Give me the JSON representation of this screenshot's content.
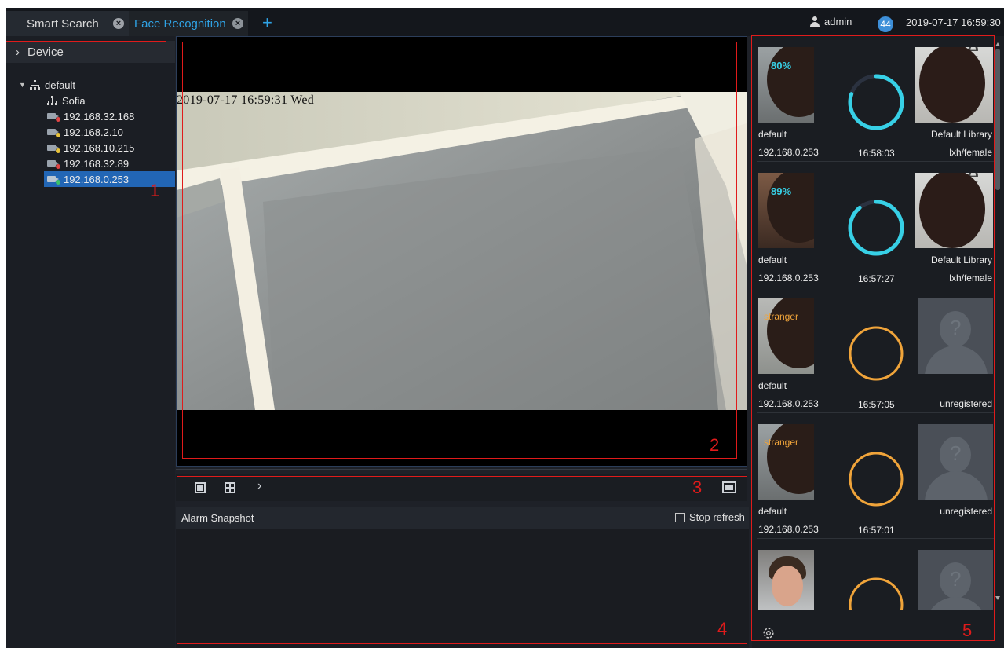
{
  "tabs": [
    {
      "label": "Smart Search",
      "active": false
    },
    {
      "label": "Face Recognition",
      "active": true
    }
  ],
  "header": {
    "user": "admin",
    "notifications": "44",
    "datetime": "2019-07-17 16:59:30"
  },
  "device_panel": {
    "title": "Device",
    "root": "default",
    "group": "Sofia",
    "devices": [
      {
        "ip": "192.168.32.168",
        "status": "offline"
      },
      {
        "ip": "192.168.2.10",
        "status": "warning"
      },
      {
        "ip": "192.168.10.215",
        "status": "warning"
      },
      {
        "ip": "192.168.32.89",
        "status": "offline"
      },
      {
        "ip": "192.168.0.253",
        "status": "online",
        "selected": true
      }
    ]
  },
  "video": {
    "osd": "2019-07-17 16:59:31 Wed"
  },
  "alarm": {
    "title": "Alarm Snapshot",
    "stop_refresh": "Stop refresh"
  },
  "feed": [
    {
      "group": "default",
      "ip": "192.168.0.253",
      "time": "16:58:03",
      "result": "80%",
      "match": 0.8,
      "library": "Default Library",
      "person": "lxh/female"
    },
    {
      "group": "default",
      "ip": "192.168.0.253",
      "time": "16:57:27",
      "result": "89%",
      "match": 0.89,
      "library": "Default Library",
      "person": "lxh/female"
    },
    {
      "group": "default",
      "ip": "192.168.0.253",
      "time": "16:57:05",
      "result": "stranger",
      "library": "",
      "person": "unregistered"
    },
    {
      "group": "default",
      "ip": "192.168.0.253",
      "time": "16:57:01",
      "result": "stranger",
      "library": "",
      "person": "unregistered"
    }
  ],
  "annotations": [
    "1",
    "2",
    "3",
    "4",
    "5"
  ],
  "colors": {
    "accent": "#2fa3e6",
    "match_ring": "#37d0e6",
    "stranger_ring": "#f0a43a",
    "annotation": "#e01b1b",
    "selected": "#2266b5"
  }
}
